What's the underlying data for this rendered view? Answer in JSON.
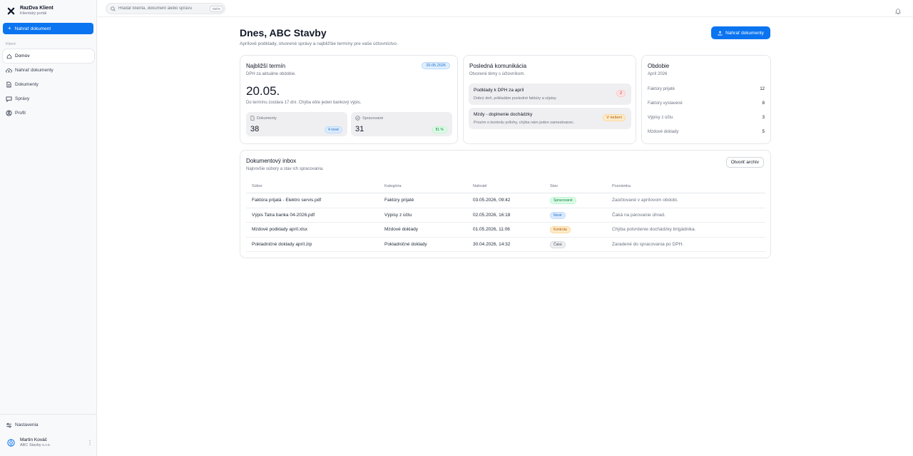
{
  "brand": {
    "name": "RazDva Klient",
    "subtitle": "Klientský portál"
  },
  "sidebar": {
    "upload_button": "Nahrať dokument",
    "section_label": "Klient",
    "items": [
      {
        "label": "Domov",
        "icon": "home-icon",
        "active": true
      },
      {
        "label": "Nahrať dokumenty",
        "icon": "cloud-upload-icon",
        "active": false
      },
      {
        "label": "Dokumenty",
        "icon": "document-icon",
        "active": false
      },
      {
        "label": "Správy",
        "icon": "chat-icon",
        "active": false
      },
      {
        "label": "Profil",
        "icon": "profile-icon",
        "active": false
      }
    ],
    "settings_label": "Nastavenia",
    "user": {
      "name": "Martin Kováč",
      "company": "ABC Stavby s.r.o."
    }
  },
  "topbar": {
    "search_placeholder": "Hľadať klienta, dokument alebo správu",
    "shortcut": "Ctrl K"
  },
  "main": {
    "title": "Dnes, ABC Stavby",
    "subtitle": "Aprílové podklady, otvorené správy a najbližšie termíny pre vaše účtovníctvo.",
    "upload_button": "Nahrať dokumenty"
  },
  "deadline": {
    "title": "Najbližší termín",
    "subtitle": "DPH za aktuálne obdobie.",
    "badge": "20.05.2026",
    "date": "20.05.",
    "note": "Do termínu zostáva 17 dní. Chýba ešte jeden bankový výpis.",
    "stats": [
      {
        "label": "Dokumenty",
        "value": "38",
        "pill": "4 nové"
      },
      {
        "label": "Spracované",
        "value": "31",
        "pill": "81 %"
      }
    ]
  },
  "communication": {
    "title": "Posledná komunikácia",
    "subtitle": "Otvorené témy s účtovníkom.",
    "threads": [
      {
        "title": "Podklady k DPH za apríl",
        "text": "Dobrý deň, prikladám posledné faktúry a výpisy.",
        "badge": "2"
      },
      {
        "title": "Mzdy - doplnenie dochádzky",
        "text": "Prosím o kontrolu prílohy, chýba nám jeden zamestnanec.",
        "badge": "V riešení"
      }
    ]
  },
  "period": {
    "title": "Obdobie",
    "subtitle": "Apríl 2026",
    "rows": [
      {
        "label": "Faktúry prijaté",
        "value": "12"
      },
      {
        "label": "Faktúry vystavené",
        "value": "8"
      },
      {
        "label": "Výpisy z účtu",
        "value": "3"
      },
      {
        "label": "Mzdové doklady",
        "value": "5"
      }
    ]
  },
  "inbox": {
    "title": "Dokumentový inbox",
    "subtitle": "Najnovšie súbory a stav ich spracovania.",
    "archive_button": "Otvoriť archív",
    "columns": [
      "Súbor",
      "Kategória",
      "Nahraté",
      "Stav",
      "Poznámka"
    ],
    "rows": [
      {
        "file": "Faktúra prijatá - Elektro servis.pdf",
        "category": "Faktúry prijaté",
        "uploaded": "03.05.2026, 09:42",
        "status": "Spracované",
        "note": "Zaúčtované v aprílovom období."
      },
      {
        "file": "Výpis Tatra banka 04-2026.pdf",
        "category": "Výpisy z účtu",
        "uploaded": "02.05.2026, 16:18",
        "status": "Nové",
        "note": "Čaká na párovanie úhrad."
      },
      {
        "file": "Mzdové podklady apríl.xlsx",
        "category": "Mzdové doklady",
        "uploaded": "01.05.2026, 11:06",
        "status": "Kontrola",
        "note": "Chýba potvrdenie dochádzky brigádnika."
      },
      {
        "file": "Pokladničné doklady apríl.zip",
        "category": "Pokladničné doklady",
        "uploaded": "30.04.2026, 14:32",
        "status": "Čaká",
        "note": "Zaradené do spracovania po DPH."
      }
    ]
  },
  "colors": {
    "accent": "#0b74f0",
    "success": "#15803d",
    "warning": "#b45309",
    "danger": "#dc2626"
  }
}
